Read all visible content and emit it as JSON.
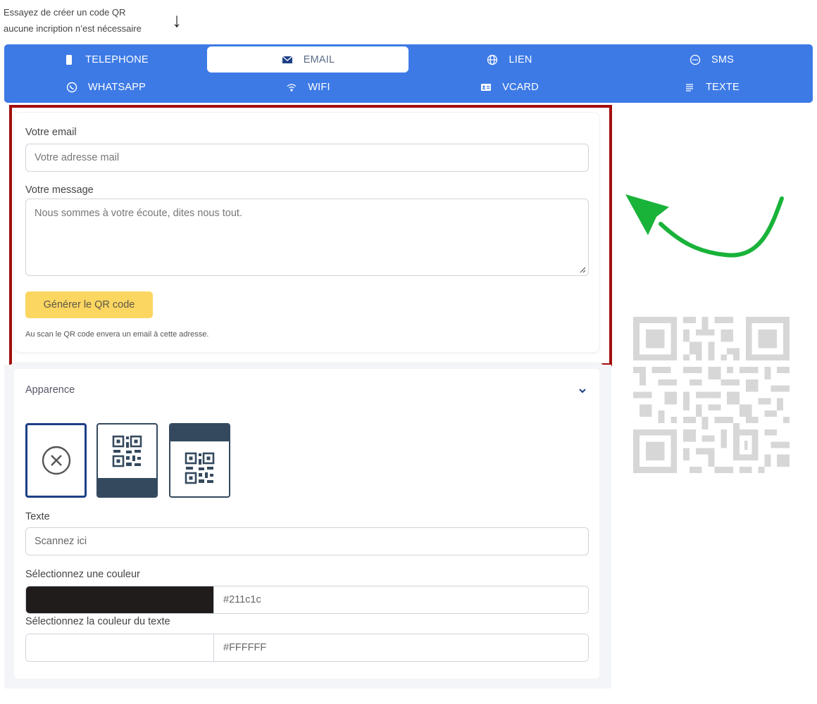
{
  "intro": {
    "line1": "Essayez de créer un code QR",
    "line2": "aucune incription n’est nécessaire",
    "arrow": "↓"
  },
  "tabs": [
    {
      "label": "TELEPHONE",
      "icon": "phone-icon"
    },
    {
      "label": "EMAIL",
      "icon": "envelope-icon",
      "active": true
    },
    {
      "label": "LIEN",
      "icon": "globe-icon"
    },
    {
      "label": "SMS",
      "icon": "chat-bubble-icon"
    },
    {
      "label": "WHATSAPP",
      "icon": "whatsapp-icon"
    },
    {
      "label": "WIFI",
      "icon": "wifi-icon"
    },
    {
      "label": "VCARD",
      "icon": "id-card-icon"
    },
    {
      "label": "TEXTE",
      "icon": "text-lines-icon"
    }
  ],
  "email_form": {
    "email_label": "Votre email",
    "email_placeholder": "Votre adresse mail",
    "message_label": "Votre message",
    "message_placeholder": "Nous sommes à votre écoute, dites nous tout.",
    "generate_button": "Générer le QR code",
    "hint": "Au scan le QR code envera un email à cette adresse."
  },
  "appearance": {
    "title": "Apparence",
    "frames": [
      "none",
      "label-bottom",
      "label-top"
    ],
    "text_label": "Texte",
    "text_value": "Scannez ici",
    "color_label": "Sélectionnez une couleur",
    "color_value": "#211c1c",
    "text_color_label": "Sélectionnez la couleur du texte",
    "text_color_value": "#FFFFFF"
  },
  "colors": {
    "tab_bar": "#3d7ae6",
    "generate_button": "#fbd661",
    "highlight_border": "#a30d0d",
    "callout_arrow": "#19b33a",
    "frame_dark": "#34495e"
  }
}
